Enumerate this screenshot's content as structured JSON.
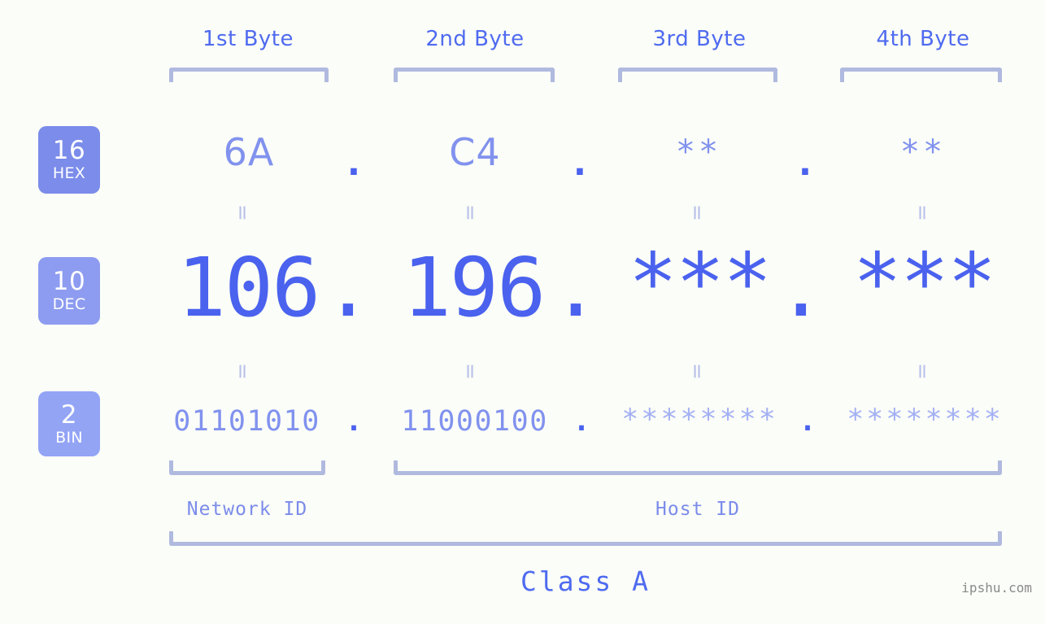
{
  "header": {
    "bytes": [
      {
        "label": "1st Byte"
      },
      {
        "label": "2nd Byte"
      },
      {
        "label": "3rd Byte"
      },
      {
        "label": "4th Byte"
      }
    ]
  },
  "badges": [
    {
      "number": "16",
      "name": "HEX",
      "color": "#7b8cea"
    },
    {
      "number": "10",
      "name": "DEC",
      "color": "#8d9cf0"
    },
    {
      "number": "2",
      "name": "BIN",
      "color": "#93a4f5"
    }
  ],
  "rows": {
    "hex": {
      "values": [
        "6A",
        "C4",
        "**",
        "**"
      ],
      "separator": "."
    },
    "dec": {
      "values": [
        "106",
        "196",
        "***",
        "***"
      ],
      "separator": "."
    },
    "bin": {
      "values": [
        "01101010",
        "11000100",
        "********",
        "********"
      ],
      "separator": "."
    }
  },
  "separators": {
    "equals": "="
  },
  "footer": {
    "network_id": "Network ID",
    "host_id": "Host ID",
    "class": "Class A",
    "watermark": "ipshu.com"
  },
  "colors": {
    "background": "#fbfdf8",
    "accent_strong": "#4a62ee",
    "accent_mid": "#7b8cea",
    "accent_light": "#a3b0f4",
    "bracket": "#b0badf"
  }
}
